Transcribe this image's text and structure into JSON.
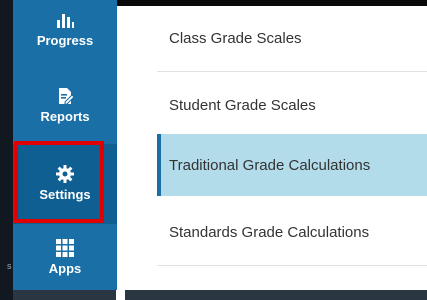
{
  "sidebar": {
    "items": [
      {
        "label": "Progress",
        "icon": "chart-bar-icon"
      },
      {
        "label": "Reports",
        "icon": "document-edit-icon"
      },
      {
        "label": "Settings",
        "icon": "gear-icon"
      },
      {
        "label": "Apps",
        "icon": "grid-icon"
      }
    ],
    "active_color": "#0f5f93",
    "background_color": "#1a6fa6",
    "highlight_color": "#e00000"
  },
  "left_strip": {
    "edge_text": "s"
  },
  "settings_menu": {
    "items": [
      {
        "label": "Class Grade Scales",
        "selected": false
      },
      {
        "label": "Student Grade Scales",
        "selected": false
      },
      {
        "label": "Traditional Grade Calculations",
        "selected": true
      },
      {
        "label": "Standards Grade Calculations",
        "selected": false
      }
    ],
    "selected_color": "#b2dcea"
  }
}
